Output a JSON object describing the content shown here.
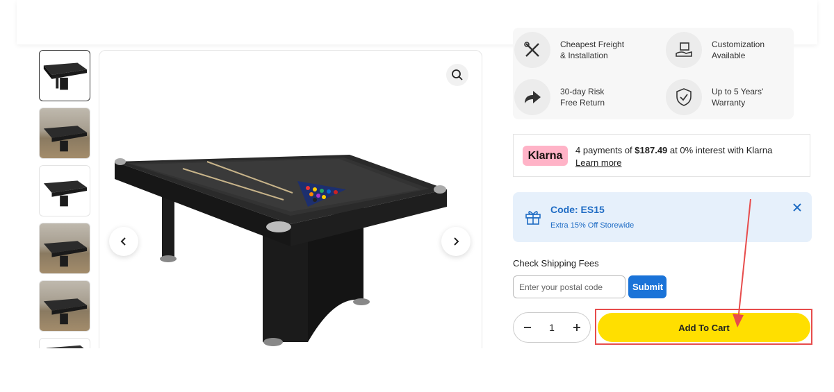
{
  "features": [
    {
      "icon": "tools-icon",
      "line1": "Cheapest Freight",
      "line2": "& Installation"
    },
    {
      "icon": "hand-box-icon",
      "line1": "Customization",
      "line2": "Available"
    },
    {
      "icon": "return-arrow-icon",
      "line1": "30-day Risk",
      "line2": "Free Return"
    },
    {
      "icon": "shield-check-icon",
      "line1": "Up to 5 Years'",
      "line2": "Warranty"
    }
  ],
  "klarna": {
    "logo": "Klarna",
    "prefix": "4 payments of ",
    "amount": "$187.49",
    "suffix": " at 0% interest with Klarna",
    "link": "Learn more"
  },
  "promo": {
    "code": "Code: ES15",
    "description": "Extra 15% Off Storewide"
  },
  "shipping": {
    "label": "Check Shipping Fees",
    "placeholder": "Enter your postal code",
    "submit": "Submit"
  },
  "quantity": {
    "value": "1"
  },
  "cart": {
    "label": "Add To Cart"
  },
  "colors": {
    "accent_blue": "#1a73d8",
    "cart_yellow": "#ffdf00",
    "highlight_red": "#e74c4c",
    "klarna_pink": "#ffb3c7"
  }
}
